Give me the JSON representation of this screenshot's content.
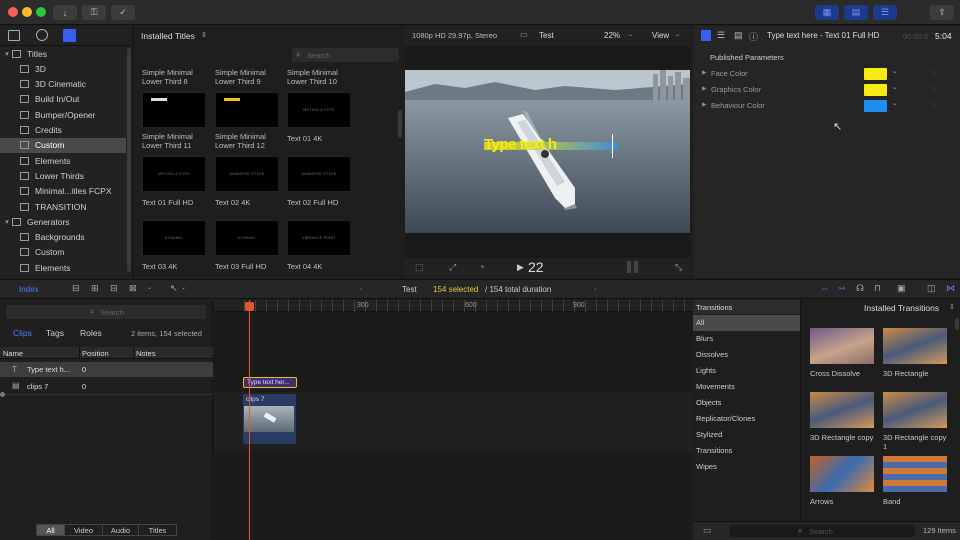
{
  "colors": {
    "accent_blue": "#3a5ef0",
    "title_clip_yellow": "#f0c020",
    "playhead": "#e4572e",
    "selected_yellow": "#e8c642"
  },
  "browser": {
    "title": "Installed Titles",
    "search_placeholder": "Search",
    "thumbs": [
      {
        "label": "Simple Minimal Lower Third 8",
        "inner": ""
      },
      {
        "label": "Simple Minimal Lower Third 9",
        "inner": ""
      },
      {
        "label": "Simple Minimal Lower Third 10",
        "inner": ""
      },
      {
        "label": "Simple Minimal Lower Third 11",
        "inner": ""
      },
      {
        "label": "Simple Minimal Lower Third 12",
        "inner": ""
      },
      {
        "label": "Text 01 4K",
        "inner": "MOTION & FCPX"
      },
      {
        "label": "Text 01 Full HD",
        "inner": "MOTION & FCPX"
      },
      {
        "label": "Text 02 4K",
        "inner": "ANIMATED TITLES"
      },
      {
        "label": "Text 02 Full HD",
        "inner": "ANIMATED TITLES"
      },
      {
        "label": "Text 03 4K",
        "inner": "DYNAMIC"
      },
      {
        "label": "Text 03 Full HD",
        "inner": "DYNAMIC"
      },
      {
        "label": "Text 04 4K",
        "inner": "VIBRANCE POINT"
      }
    ]
  },
  "library": {
    "items": [
      {
        "label": "Titles",
        "level": 0
      },
      {
        "label": "3D",
        "level": 1
      },
      {
        "label": "3D Cinematic",
        "level": 1
      },
      {
        "label": "Build In/Out",
        "level": 1
      },
      {
        "label": "Bumper/Opener",
        "level": 1
      },
      {
        "label": "Credits",
        "level": 1
      },
      {
        "label": "Custom",
        "level": 1,
        "selected": true
      },
      {
        "label": "Elements",
        "level": 1
      },
      {
        "label": "Lower Thirds",
        "level": 1
      },
      {
        "label": "Minimal...itles FCPX",
        "level": 1
      },
      {
        "label": "TRANSITION",
        "level": 1
      },
      {
        "label": "Generators",
        "level": 0
      },
      {
        "label": "Backgrounds",
        "level": 1
      },
      {
        "label": "Custom",
        "level": 1
      },
      {
        "label": "Elements",
        "level": 1
      }
    ]
  },
  "viewer": {
    "format": "1080p HD 29.97p, Stereo",
    "project": "Test",
    "zoom": "22%",
    "view_label": "View",
    "overlay_text": "Type text h",
    "frame_counter": "22"
  },
  "inspector": {
    "clip_name": "Type text here - Text 01 Full HD",
    "timecode_dim": "00:00:0",
    "timecode": "5:04",
    "section": "Published Parameters",
    "params": [
      {
        "label": "Face Color",
        "color": "#f5eb14"
      },
      {
        "label": "Graphics Color",
        "color": "#f5eb14"
      },
      {
        "label": "Behaviour Color",
        "color": "#1f8cf0"
      }
    ]
  },
  "toolbar": {
    "index_tab": "Index",
    "project_name": "Test",
    "selected_info": "154 selected",
    "total_info": "/ 154 total duration"
  },
  "index": {
    "search_placeholder": "Search",
    "tabs": [
      "Clips",
      "Tags",
      "Roles"
    ],
    "count": "2 items, 154 selected",
    "columns": [
      "Name",
      "Position",
      "Notes"
    ],
    "rows": [
      {
        "name": "Type text h...",
        "position": "0"
      },
      {
        "name": "clips 7",
        "position": "0"
      }
    ],
    "filters": [
      "All",
      "Video",
      "Audio",
      "Titles"
    ]
  },
  "timeline": {
    "ruler_marks": [
      "300",
      "600",
      "900"
    ],
    "title_clip": "Type text her...",
    "video_clip": "clips 7"
  },
  "transitions": {
    "header_left": "Transitions",
    "header_right": "Installed Transitions",
    "categories": [
      "All",
      "Blurs",
      "Dissolves",
      "Lights",
      "Movements",
      "Objects",
      "Replicator/Clones",
      "Stylized",
      "Transitions",
      "Wipes"
    ],
    "items": [
      {
        "label": "Cross Dissolve"
      },
      {
        "label": "3D Rectangle"
      },
      {
        "label": "3D Rectangle copy"
      },
      {
        "label": "3D Rectangle copy 1"
      },
      {
        "label": "Arrows"
      },
      {
        "label": "Band"
      }
    ],
    "search_placeholder": "Search",
    "count": "129 Items"
  }
}
